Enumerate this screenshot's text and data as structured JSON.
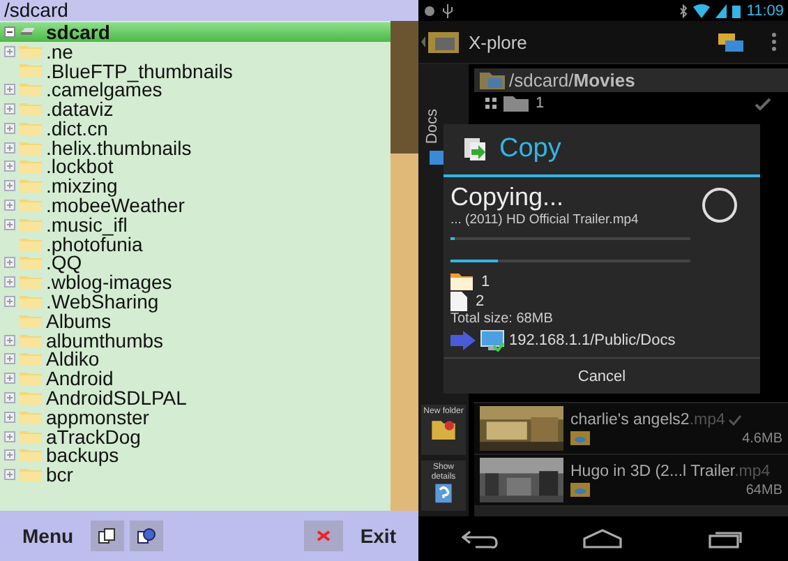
{
  "file_browser": {
    "path": "/sdcard",
    "tree": {
      "label": "sdcard",
      "selected": true,
      "children": [
        {
          "label": ".ne",
          "expandable": true
        },
        {
          "label": ".BlueFTP_thumbnails",
          "expandable": false
        },
        {
          "label": ".camelgames",
          "expandable": true
        },
        {
          "label": ".dataviz",
          "expandable": true
        },
        {
          "label": ".dict.cn",
          "expandable": true
        },
        {
          "label": ".helix.thumbnails",
          "expandable": true
        },
        {
          "label": ".lockbot",
          "expandable": true
        },
        {
          "label": ".mixzing",
          "expandable": true
        },
        {
          "label": ".mobeeWeather",
          "expandable": true
        },
        {
          "label": ".music_ifl",
          "expandable": true
        },
        {
          "label": ".photofunia",
          "expandable": false
        },
        {
          "label": ".QQ",
          "expandable": true
        },
        {
          "label": ".wblog-images",
          "expandable": true
        },
        {
          "label": ".WebSharing",
          "expandable": true
        },
        {
          "label": "Albums",
          "expandable": false
        },
        {
          "label": "albumthumbs",
          "expandable": true
        },
        {
          "label": "Aldiko",
          "expandable": true
        },
        {
          "label": "Android",
          "expandable": true
        },
        {
          "label": "AndroidSDLPAL",
          "expandable": true
        },
        {
          "label": "appmonster",
          "expandable": true
        },
        {
          "label": "aTrackDog",
          "expandable": true
        },
        {
          "label": "backups",
          "expandable": true
        },
        {
          "label": "bcr",
          "expandable": true
        }
      ]
    },
    "toolbar": {
      "menu": "Menu",
      "exit": "Exit"
    }
  },
  "xplore": {
    "status_bar": {
      "time": "11:09"
    },
    "app_title": "X-plore",
    "path": {
      "parent": "/sdcard/",
      "current": "Movies"
    },
    "folder_row": {
      "label": "1",
      "checked": true
    },
    "side_tab": "Docs",
    "side_buttons": [
      {
        "label": "New folder"
      },
      {
        "label": "Show details"
      }
    ],
    "files": [
      {
        "name": "charlie's angels2",
        "ext": ".mp4",
        "size": "4.6MB",
        "checked": true
      },
      {
        "name": "Hugo in 3D (2...l Trailer",
        "ext": ".mp4",
        "size": "64MB",
        "checked": false
      }
    ],
    "dialog": {
      "title": "Copy",
      "status": "Copying...",
      "file": "... (2011) HD Official Trailer.mp4",
      "progress": [
        {
          "level": 0.02
        },
        {
          "level": 0.2
        }
      ],
      "items": [
        {
          "kind": "folder",
          "count": "1"
        },
        {
          "kind": "file",
          "count": "2"
        }
      ],
      "total": "Total size: 68MB",
      "destination": "192.168.1.1/Public/Docs",
      "cancel": "Cancel"
    }
  }
}
